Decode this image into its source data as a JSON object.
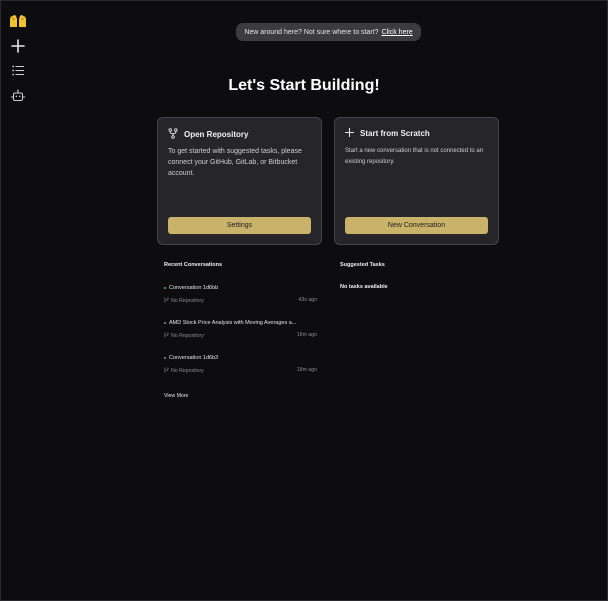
{
  "sidebar": {
    "items": [
      {
        "icon": "hands-logo-icon"
      },
      {
        "icon": "plus-icon"
      },
      {
        "icon": "list-icon"
      },
      {
        "icon": "robot-icon"
      }
    ]
  },
  "banner": {
    "text": "New around here? Not sure where to start?",
    "link": "Click here"
  },
  "main": {
    "title": "Let's Start Building!"
  },
  "cards": {
    "repo": {
      "title": "Open Repository",
      "description": "To get started with suggested tasks, please connect your GitHub, GitLab, or Bitbucket account.",
      "button": "Settings",
      "icon": "git-branch-icon"
    },
    "scratch": {
      "title": "Start from Scratch",
      "description": "Start a new conversation that is not connected to an existing repository.",
      "button": "New Conversation",
      "icon": "plus-icon"
    }
  },
  "recent": {
    "title": "Recent Conversations",
    "items": [
      {
        "title": "Conversation 1d6bb",
        "repo": "No Repository",
        "time": "43s ago",
        "status_color": "#3fbf6f"
      },
      {
        "title": "AMD Stock Price Analysis with Moving Averages a...",
        "repo": "No Repository",
        "time": "16m ago",
        "status_color": "#8a8a8a"
      },
      {
        "title": "Conversation 1d6b3",
        "repo": "No Repository",
        "time": "18m ago",
        "status_color": "#8a8a8a"
      }
    ],
    "view_more": "View More"
  },
  "suggested": {
    "title": "Suggested Tasks",
    "empty": "No tasks available"
  },
  "colors": {
    "background": "#0d0d0f",
    "card": "#25252a",
    "accent": "#c9b36a",
    "banner": "#3b3b40"
  }
}
